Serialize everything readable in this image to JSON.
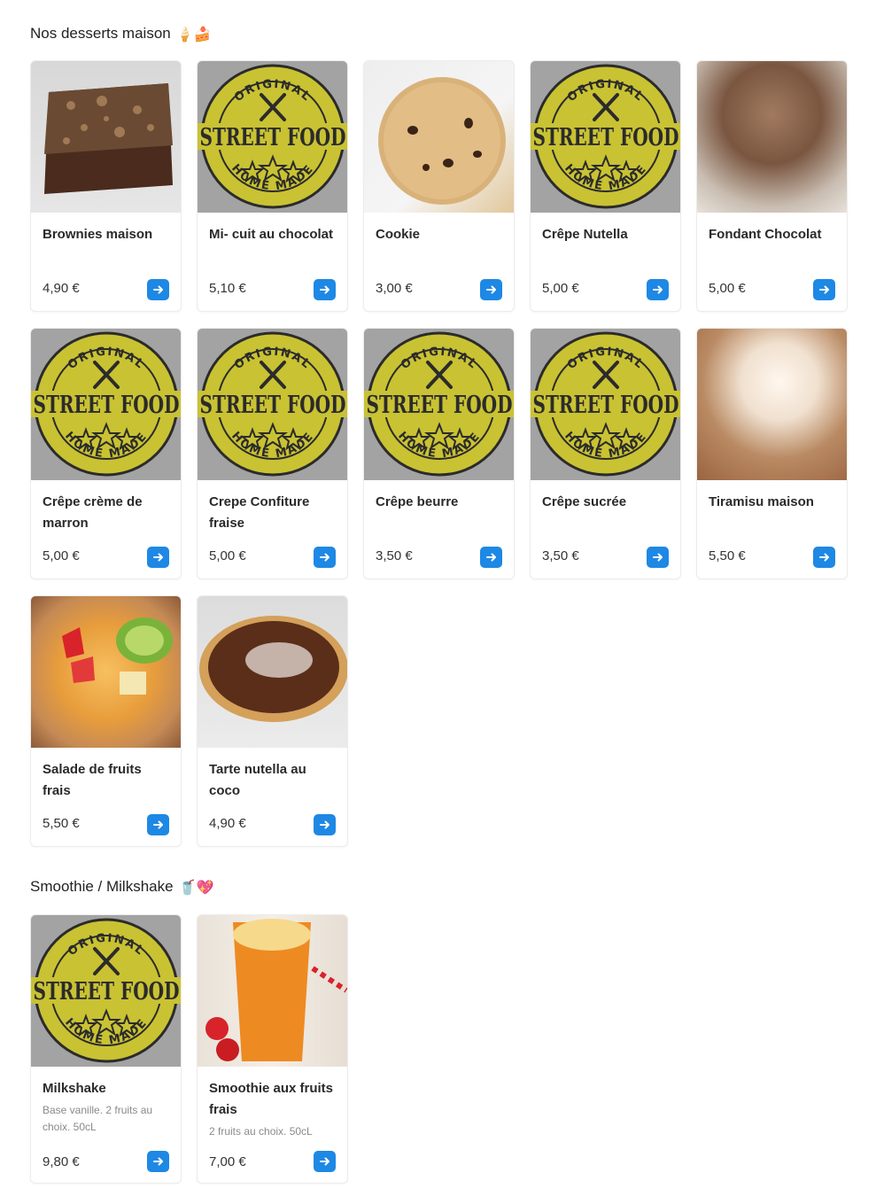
{
  "sections": [
    {
      "title": "Nos desserts maison",
      "emoji": "🍦🍰",
      "items": [
        {
          "name": "Brownies maison",
          "price": "4,90 €",
          "image": "brownie-photo"
        },
        {
          "name": "Mi- cuit au chocolat",
          "price": "5,10 €",
          "image": "streetfood-logo"
        },
        {
          "name": "Cookie",
          "price": "3,00 €",
          "image": "cookie-photo"
        },
        {
          "name": "Crêpe Nutella",
          "price": "5,00 €",
          "image": "streetfood-logo"
        },
        {
          "name": "Fondant Chocolat",
          "price": "5,00 €",
          "image": "fondant-photo"
        },
        {
          "name": "Crêpe crème de marron",
          "price": "5,00 €",
          "image": "streetfood-logo"
        },
        {
          "name": "Crepe Confiture fraise",
          "price": "5,00 €",
          "image": "streetfood-logo"
        },
        {
          "name": "Crêpe beurre",
          "price": "3,50 €",
          "image": "streetfood-logo"
        },
        {
          "name": "Crêpe sucrée",
          "price": "3,50 €",
          "image": "streetfood-logo"
        },
        {
          "name": "Tiramisu maison",
          "price": "5,50 €",
          "image": "tiramisu-photo"
        },
        {
          "name": "Salade de fruits frais",
          "price": "5,50 €",
          "image": "fruit-salad-photo"
        },
        {
          "name": "Tarte nutella au coco",
          "price": "4,90 €",
          "image": "tart-photo"
        }
      ]
    },
    {
      "title": "Smoothie / Milkshake",
      "emoji": "🥤💖",
      "items": [
        {
          "name": "Milkshake",
          "description": "Base vanille. 2 fruits au choix. 50cL",
          "price": "9,80 €",
          "image": "streetfood-logo"
        },
        {
          "name": "Smoothie aux fruits frais",
          "description": "2 fruits au choix. 50cL",
          "price": "7,00 €",
          "image": "smoothie-photo"
        }
      ]
    }
  ],
  "logo": {
    "top_text": "ORIGINAL",
    "main_text": "STREET FOOD",
    "bottom_text": "HOME MADE",
    "colors": {
      "ring": "#c9c233",
      "dark": "#2b2b2b",
      "background": "#a3a3a3"
    }
  },
  "colors": {
    "accent": "#1e88e5"
  }
}
